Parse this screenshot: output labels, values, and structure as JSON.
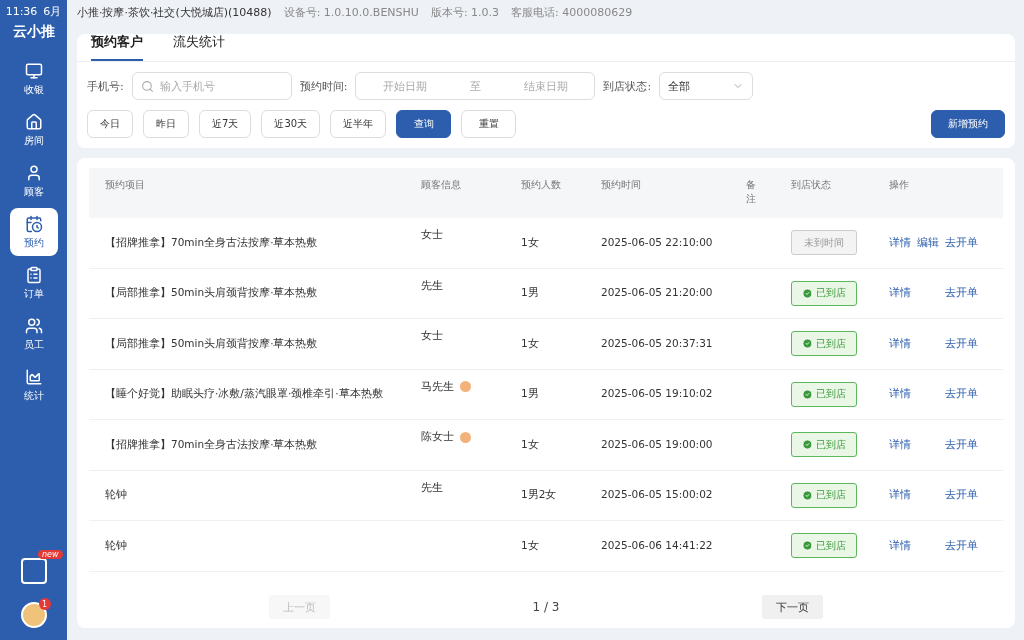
{
  "status_bar": {
    "time": "11:36",
    "date": "6月",
    "store": "小推·按摩·茶饮·社交(大悦城店)(10488)",
    "device": "设备号: 1.0.10.0.BENSHU",
    "version": "版本号: 1.0.3",
    "hotline": "客服电话: 4000080629"
  },
  "sidebar": {
    "logo": "云小推",
    "items": [
      {
        "label": "收银",
        "selected": false
      },
      {
        "label": "房间",
        "selected": false
      },
      {
        "label": "顾客",
        "selected": false
      },
      {
        "label": "预约",
        "selected": true
      },
      {
        "label": "订单",
        "selected": false
      },
      {
        "label": "员工",
        "selected": false
      },
      {
        "label": "统计",
        "selected": false
      }
    ],
    "promo_badge": "new",
    "avatar_badge": "1"
  },
  "tabs": [
    {
      "label": "预约客户",
      "selected": true
    },
    {
      "label": "流失统计",
      "selected": false
    }
  ],
  "filters": {
    "phone_label": "手机号:",
    "phone_placeholder": "输入手机号",
    "time_label": "预约时间:",
    "start_placeholder": "开始日期",
    "range_sep": "至",
    "end_placeholder": "结束日期",
    "status_label": "到店状态:",
    "status_value": "全部"
  },
  "quick_ranges": [
    {
      "label": "今日"
    },
    {
      "label": "昨日"
    },
    {
      "label": "近7天"
    },
    {
      "label": "近30天"
    },
    {
      "label": "近半年"
    }
  ],
  "buttons": {
    "query": "查询",
    "reset": "重置",
    "new": "新增预约"
  },
  "table": {
    "columns": [
      "预约项目",
      "顾客信息",
      "预约人数",
      "预约时间",
      "备注",
      "到店状态",
      "操作"
    ],
    "rows": [
      {
        "project": "【招牌推拿】70min全身古法按摩·草本热敷",
        "customer": "女士",
        "vip": false,
        "count": "1女",
        "time": "2025-06-05 22:10:00",
        "status": "未到时间",
        "arrived": false,
        "actions": [
          "详情",
          "编辑",
          "去开单"
        ]
      },
      {
        "project": "【局部推拿】50min头肩颈背按摩·草本热敷",
        "customer": "先生",
        "vip": false,
        "count": "1男",
        "time": "2025-06-05 21:20:00",
        "status": "已到店",
        "arrived": true,
        "actions": [
          "详情",
          "去开单"
        ]
      },
      {
        "project": "【局部推拿】50min头肩颈背按摩·草本热敷",
        "customer": "女士",
        "vip": false,
        "count": "1女",
        "time": "2025-06-05 20:37:31",
        "status": "已到店",
        "arrived": true,
        "actions": [
          "详情",
          "去开单"
        ]
      },
      {
        "project": "【睡个好觉】助眠头疗·冰敷/蒸汽眼罩·颈椎牵引·草本热敷",
        "customer": "马先生",
        "vip": true,
        "count": "1男",
        "time": "2025-06-05 19:10:02",
        "status": "已到店",
        "arrived": true,
        "actions": [
          "详情",
          "去开单"
        ]
      },
      {
        "project": "【招牌推拿】70min全身古法按摩·草本热敷",
        "customer": "陈女士",
        "vip": true,
        "count": "1女",
        "time": "2025-06-05 19:00:00",
        "status": "已到店",
        "arrived": true,
        "actions": [
          "详情",
          "去开单"
        ]
      },
      {
        "project": "轮钟",
        "customer": "先生",
        "vip": false,
        "count": "1男2女",
        "time": "2025-06-05 15:00:02",
        "status": "已到店",
        "arrived": true,
        "actions": [
          "详情",
          "去开单"
        ]
      },
      {
        "project": "轮钟",
        "vip": false,
        "count": "1女",
        "time": "2025-06-06 14:41:22",
        "status": "已到店",
        "arrived": true,
        "actions": [
          "详情",
          "去开单"
        ]
      }
    ]
  },
  "pagination": {
    "prev": "上一页",
    "page": "1 / 3",
    "next": "下一页",
    "prev_disabled": true
  }
}
